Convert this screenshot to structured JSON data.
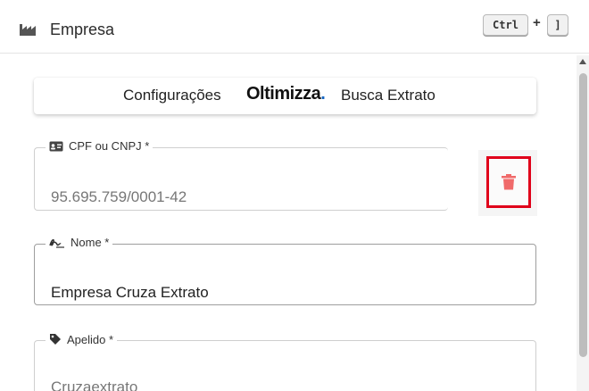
{
  "header": {
    "title": "Empresa",
    "shortcut": {
      "key1": "Ctrl",
      "plus": "+",
      "key2": "]"
    }
  },
  "config": {
    "label": "Configurações",
    "brand": "Oltimizza",
    "brand_dot": ".",
    "product": "Busca Extrato"
  },
  "form": {
    "cpf": {
      "label": "CPF ou CNPJ *",
      "value": "95.695.759/0001-42"
    },
    "nome": {
      "label": "Nome *",
      "value": "Empresa Cruza Extrato"
    },
    "apelido": {
      "label": "Apelido *",
      "value": "Cruzaextrato"
    }
  },
  "colors": {
    "highlight": "#e0001a",
    "trash": "#f06a6a",
    "brand_dot": "#1565c0"
  },
  "icons": [
    "factory-icon",
    "id-card-icon",
    "signature-icon",
    "tag-icon",
    "trash-icon"
  ]
}
